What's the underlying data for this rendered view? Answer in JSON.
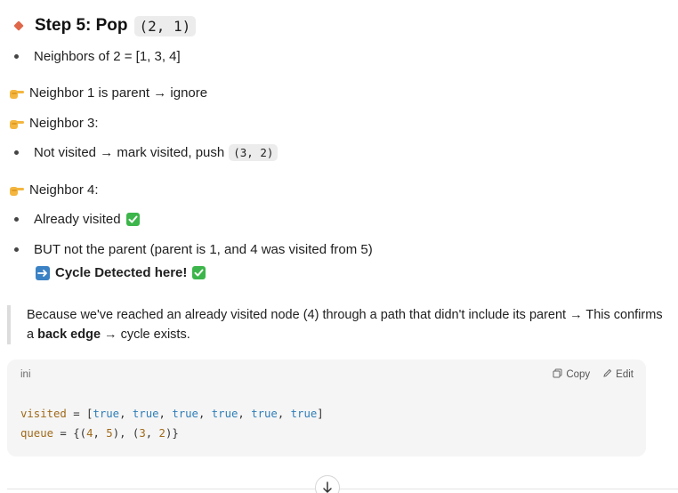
{
  "step": {
    "title": "Step 5: Pop",
    "code": "(2, 1)"
  },
  "neighbors_line": "Neighbors of 2 = [1, 3, 4]",
  "neighbor1": "Neighbor 1 is parent → ignore",
  "neighbor3": {
    "label": "Neighbor 3:",
    "item_text": "Not visited → mark visited, push",
    "item_code": "(3, 2)"
  },
  "neighbor4": {
    "label": "Neighbor 4:",
    "item1": "Already visited",
    "item2": "BUT not the parent (parent is 1, and 4 was visited from 5)",
    "cycle": "Cycle Detected here!"
  },
  "quote": {
    "part1": "Because we've reached an already visited node (4) through a path that didn't include its parent → This confirms a ",
    "bold": "back edge",
    "part2": " → cycle exists."
  },
  "code_block": {
    "language": "ini",
    "copy_label": "Copy",
    "edit_label": "Edit",
    "line1": {
      "var": "visited",
      "eq": " = [",
      "vals": [
        "true",
        "true",
        "true",
        "true",
        "true",
        "true"
      ]
    },
    "line2": {
      "var": "queue",
      "eq": " = {(",
      "a": "4",
      "b": "5",
      "c": "3",
      "d": "2"
    }
  },
  "colors": {
    "accent_diamond": "#e0684a",
    "check_green": "#3cb54a",
    "arrow_blue": "#3b82c4",
    "code_keyword": "#2f7db8",
    "code_variable": "#a06a1a"
  },
  "icons": [
    "diamond-bullet-icon",
    "pointing-hand-icon",
    "check-mark-icon",
    "right-arrow-icon",
    "copy-icon",
    "edit-icon",
    "scroll-down-arrow-icon"
  ]
}
